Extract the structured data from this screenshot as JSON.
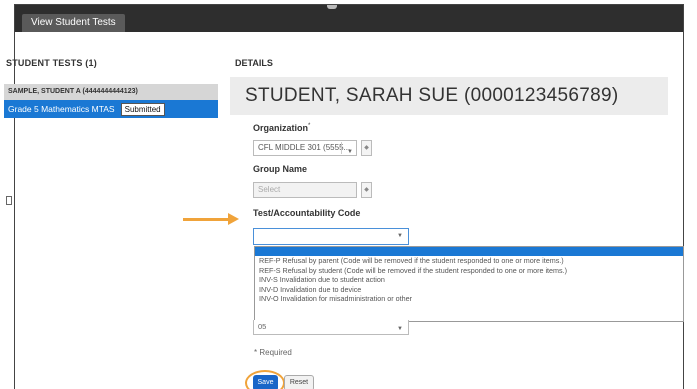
{
  "window": {
    "tab_label": "View Student Tests"
  },
  "left_panel": {
    "heading": "STUDENT TESTS (1)",
    "student_label": "SAMPLE, STUDENT A (4444444444123)",
    "test_label": "Grade 5 Mathematics MTAS",
    "test_status": "Submitted"
  },
  "details": {
    "heading": "DETAILS",
    "student_name": "STUDENT, SARAH SUE (0000123456789)",
    "organization_label": "Organization",
    "organization_required_mark": "*",
    "organization_value": "CFL MIDDLE 301 (5555...",
    "group_label": "Group Name",
    "group_placeholder": "Select",
    "code_label": "Test/Accountability Code",
    "code_value": "",
    "code_options": [
      "",
      "REF-P Refusal by parent (Code will be removed if the student responded to one or more items.)",
      "REF-S Refusal by student (Code will be removed if the student responded to one or more items.)",
      "INV-S Invalidation due to student action",
      "INV-D Invalidation due to device",
      "INV-O Invalidation for misadministration or other"
    ],
    "under_select_value": "05",
    "required_note": "* Required"
  },
  "actions": {
    "save_label": "Save",
    "reset_label": "Reset"
  },
  "colors": {
    "accent": "#1a78d4",
    "highlight_arrow": "#f0a33a",
    "topbar": "#2e2e2e"
  }
}
